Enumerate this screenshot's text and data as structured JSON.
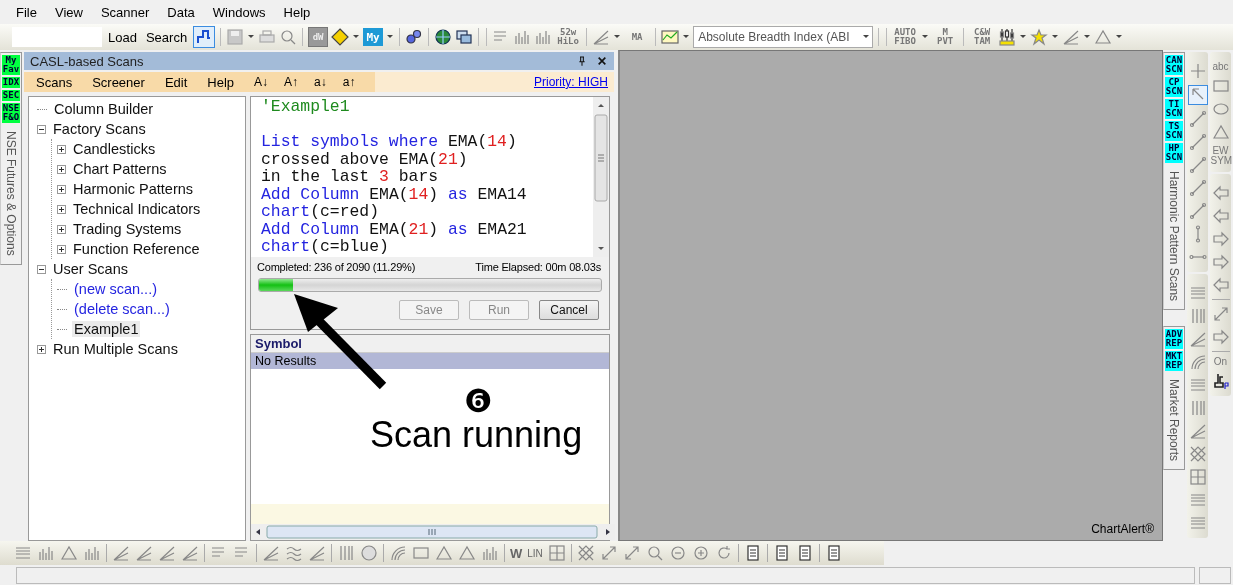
{
  "menu": [
    "File",
    "View",
    "Scanner",
    "Data",
    "Windows",
    "Help"
  ],
  "toolbar": {
    "buttons": [
      "Load",
      "Search"
    ],
    "scan_button_pressed": true,
    "indicator": "Absolute Breadth Index (ABI",
    "text_tools": [
      {
        "label": "dW",
        "kind": "box"
      },
      {
        "label": "My",
        "kind": "tile"
      },
      {
        "label": "52w HiLo",
        "kind": "glyph"
      },
      {
        "label": "MA",
        "kind": "glyph"
      },
      {
        "label": "AUTO FIBO",
        "kind": "glyph"
      },
      {
        "label": "M PVT",
        "kind": "glyph"
      },
      {
        "label": "C&W TAM",
        "kind": "glyph"
      }
    ]
  },
  "left_dock": {
    "badges": [
      "My Fav",
      "IDX",
      "SEC",
      "NSE F&O"
    ],
    "tab": "NSE Futures & Options"
  },
  "scan_panel": {
    "title": "CASL-based Scans",
    "menu": [
      "Scans",
      "Screener",
      "Edit",
      "Help"
    ],
    "font_buttons": [
      "A↓",
      "A↑",
      "a↓",
      "a↑"
    ],
    "priority": "Priority: HIGH",
    "tree": [
      {
        "label": "Column Builder",
        "kind": "entry",
        "selected": false
      },
      {
        "label": "Factory Scans",
        "kind": "entry",
        "expanded": true,
        "selected": false,
        "children": [
          {
            "label": "Candlesticks",
            "kind": "entry",
            "expanded": false,
            "selected": false
          },
          {
            "label": "Chart Patterns",
            "kind": "entry",
            "expanded": false,
            "selected": false
          },
          {
            "label": "Harmonic Patterns",
            "kind": "entry",
            "expanded": false,
            "selected": false
          },
          {
            "label": "Technical Indicators",
            "kind": "entry",
            "expanded": false,
            "selected": false
          },
          {
            "label": "Trading Systems",
            "kind": "entry",
            "expanded": false,
            "selected": false
          },
          {
            "label": "Function Reference",
            "kind": "entry",
            "expanded": false,
            "selected": false
          }
        ]
      },
      {
        "label": "User Scans",
        "kind": "entry",
        "expanded": true,
        "selected": false,
        "children": [
          {
            "label": "(new scan...)",
            "kind": "action",
            "selected": false
          },
          {
            "label": "(delete scan...)",
            "kind": "action",
            "selected": false
          },
          {
            "label": "Example1",
            "kind": "entry",
            "selected": true
          }
        ]
      },
      {
        "label": "Run Multiple Scans",
        "kind": "entry",
        "expanded": false,
        "selected": false
      }
    ],
    "editor": {
      "paragraphs": [
        [
          [
            {
              "kind": "comment",
              "text": "'Example1"
            }
          ]
        ],
        [
          [
            {
              "kind": "keyword",
              "text": "List symbols where"
            },
            {
              "kind": "plain",
              "text": " EMA("
            },
            {
              "kind": "number",
              "text": "14"
            },
            {
              "kind": "plain",
              "text": ")"
            }
          ],
          [
            {
              "kind": "plain",
              "text": "crossed above EMA("
            },
            {
              "kind": "number",
              "text": "21"
            },
            {
              "kind": "plain",
              "text": ")"
            }
          ],
          [
            {
              "kind": "plain",
              "text": "in the last "
            },
            {
              "kind": "number",
              "text": "3"
            },
            {
              "kind": "plain",
              "text": " bars"
            }
          ],
          [
            {
              "kind": "keyword",
              "text": "Add Column"
            },
            {
              "kind": "plain",
              "text": " EMA("
            },
            {
              "kind": "number",
              "text": "14"
            },
            {
              "kind": "plain",
              "text": ") "
            },
            {
              "kind": "keyword",
              "text": "as"
            },
            {
              "kind": "plain",
              "text": " EMA14"
            }
          ],
          [
            {
              "kind": "keyword",
              "text": "chart"
            },
            {
              "kind": "plain",
              "text": "(c=red)"
            }
          ],
          [
            {
              "kind": "keyword",
              "text": "Add Column"
            },
            {
              "kind": "plain",
              "text": " EMA("
            },
            {
              "kind": "number",
              "text": "21"
            },
            {
              "kind": "plain",
              "text": ") "
            },
            {
              "kind": "keyword",
              "text": "as"
            },
            {
              "kind": "plain",
              "text": " EMA21"
            }
          ],
          [
            {
              "kind": "keyword",
              "text": "chart"
            },
            {
              "kind": "plain",
              "text": "(c=blue)"
            }
          ]
        ]
      ]
    },
    "progress": {
      "completed": "Completed: 236 of 2090 (11.29%)",
      "elapsed": "Time Elapsed: 00m 08.03s",
      "level": 0.1
    },
    "buttons": [
      {
        "label": "Save",
        "disabled": true
      },
      {
        "label": "Run",
        "disabled": true
      },
      {
        "label": "Cancel",
        "disabled": false
      }
    ],
    "results": {
      "columns": [
        "Symbol"
      ],
      "rows": [
        {
          "text": "No Results",
          "selected": true
        }
      ]
    }
  },
  "chart_area": {
    "brand": "ChartAlert®"
  },
  "right_dock": [
    {
      "badges": [
        "CAN SCN",
        "CP SCN",
        "TI SCN",
        "TS SCN",
        "HP SCN"
      ],
      "tab": "Harmonic Pattern Scans"
    },
    {
      "badges": [
        "ADV REP",
        "MKT REP"
      ],
      "tab": "Market Reports"
    }
  ],
  "drawing_tools": {
    "pointer_selected": true,
    "text_tools": [
      "abc",
      "EW SYM",
      "On"
    ]
  },
  "bottom_toolbar": {
    "text_tools": [
      "W",
      "LIN"
    ]
  },
  "annotation": {
    "number": "❻",
    "text": "Scan running"
  }
}
